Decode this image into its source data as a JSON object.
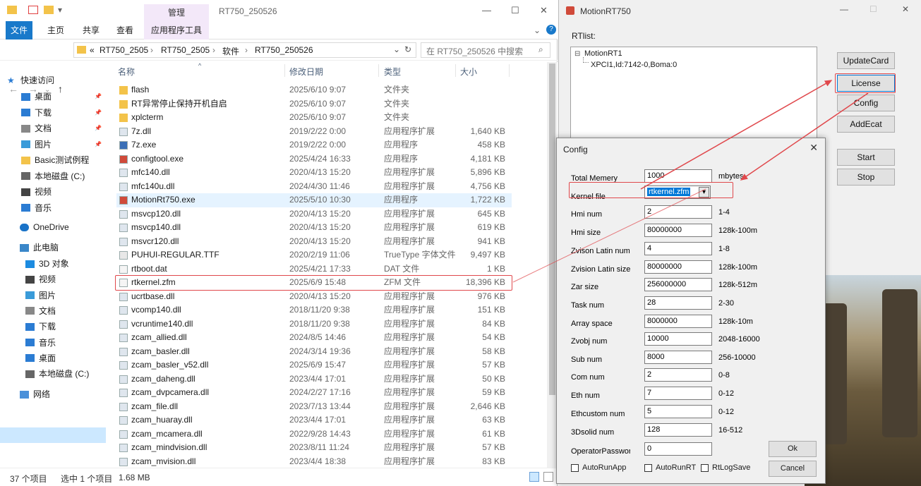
{
  "explorer": {
    "title": "RT750_250526",
    "context_tab": "管理",
    "ribbon_tabs": [
      "文件",
      "主页",
      "共享",
      "查看",
      "应用程序工具"
    ],
    "address": {
      "prefix": "«",
      "parts": [
        "RT750_2505",
        "RT750_2505",
        "软件",
        "RT750_250526"
      ]
    },
    "search_placeholder": "在 RT750_250526 中搜索",
    "nav": {
      "quick_access": "快速访问",
      "quick_items": [
        "桌面",
        "下载",
        "文档",
        "图片",
        "Basic测试例程",
        "本地磁盘 (C:)",
        "视频",
        "音乐"
      ],
      "onedrive": "OneDrive",
      "this_pc": "此电脑",
      "pc_items": [
        "3D 对象",
        "视频",
        "图片",
        "文档",
        "下载",
        "音乐",
        "桌面",
        "本地磁盘 (C:)"
      ],
      "network": "网络"
    },
    "columns": {
      "name": "名称",
      "date": "修改日期",
      "type": "类型",
      "size": "大小"
    },
    "files": [
      {
        "name": "flash",
        "date": "2025/6/10 9:07",
        "type": "文件夹",
        "size": "",
        "kind": "folder"
      },
      {
        "name": "RT异常停止保持开机自启",
        "date": "2025/6/10 9:07",
        "type": "文件夹",
        "size": "",
        "kind": "folder"
      },
      {
        "name": "xplcterm",
        "date": "2025/6/10 9:07",
        "type": "文件夹",
        "size": "",
        "kind": "folder"
      },
      {
        "name": "7z.dll",
        "date": "2019/2/22 0:00",
        "type": "应用程序扩展",
        "size": "1,640 KB",
        "kind": "dll"
      },
      {
        "name": "7z.exe",
        "date": "2019/2/22 0:00",
        "type": "应用程序",
        "size": "458 KB",
        "kind": "exe"
      },
      {
        "name": "configtool.exe",
        "date": "2025/4/24 16:33",
        "type": "应用程序",
        "size": "4,181 KB",
        "kind": "app"
      },
      {
        "name": "mfc140.dll",
        "date": "2020/4/13 15:20",
        "type": "应用程序扩展",
        "size": "5,896 KB",
        "kind": "dll"
      },
      {
        "name": "mfc140u.dll",
        "date": "2024/4/30 11:46",
        "type": "应用程序扩展",
        "size": "4,756 KB",
        "kind": "dll"
      },
      {
        "name": "MotionRt750.exe",
        "date": "2025/5/10 10:30",
        "type": "应用程序",
        "size": "1,722 KB",
        "kind": "app",
        "selected": true
      },
      {
        "name": "msvcp120.dll",
        "date": "2020/4/13 15:20",
        "type": "应用程序扩展",
        "size": "645 KB",
        "kind": "dll"
      },
      {
        "name": "msvcp140.dll",
        "date": "2020/4/13 15:20",
        "type": "应用程序扩展",
        "size": "619 KB",
        "kind": "dll"
      },
      {
        "name": "msvcr120.dll",
        "date": "2020/4/13 15:20",
        "type": "应用程序扩展",
        "size": "941 KB",
        "kind": "dll"
      },
      {
        "name": "PUHUI-REGULAR.TTF",
        "date": "2020/2/19 11:06",
        "type": "TrueType 字体文件",
        "size": "9,497 KB",
        "kind": "font"
      },
      {
        "name": "rtboot.dat",
        "date": "2025/4/21 17:33",
        "type": "DAT 文件",
        "size": "1 KB",
        "kind": "file"
      },
      {
        "name": "rtkernel.zfm",
        "date": "2025/6/9 15:48",
        "type": "ZFM 文件",
        "size": "18,396 KB",
        "kind": "file",
        "highlight": true
      },
      {
        "name": "ucrtbase.dll",
        "date": "2020/4/13 15:20",
        "type": "应用程序扩展",
        "size": "976 KB",
        "kind": "dll"
      },
      {
        "name": "vcomp140.dll",
        "date": "2018/11/20 9:38",
        "type": "应用程序扩展",
        "size": "151 KB",
        "kind": "dll"
      },
      {
        "name": "vcruntime140.dll",
        "date": "2018/11/20 9:38",
        "type": "应用程序扩展",
        "size": "84 KB",
        "kind": "dll"
      },
      {
        "name": "zcam_allied.dll",
        "date": "2024/8/5 14:46",
        "type": "应用程序扩展",
        "size": "54 KB",
        "kind": "dll"
      },
      {
        "name": "zcam_basler.dll",
        "date": "2024/3/14 19:36",
        "type": "应用程序扩展",
        "size": "58 KB",
        "kind": "dll"
      },
      {
        "name": "zcam_basler_v52.dll",
        "date": "2025/6/9 15:47",
        "type": "应用程序扩展",
        "size": "57 KB",
        "kind": "dll"
      },
      {
        "name": "zcam_daheng.dll",
        "date": "2023/4/4 17:01",
        "type": "应用程序扩展",
        "size": "50 KB",
        "kind": "dll"
      },
      {
        "name": "zcam_dvpcamera.dll",
        "date": "2024/2/27 17:16",
        "type": "应用程序扩展",
        "size": "59 KB",
        "kind": "dll"
      },
      {
        "name": "zcam_file.dll",
        "date": "2023/7/13 13:44",
        "type": "应用程序扩展",
        "size": "2,646 KB",
        "kind": "dll"
      },
      {
        "name": "zcam_huaray.dll",
        "date": "2023/4/4 17:01",
        "type": "应用程序扩展",
        "size": "63 KB",
        "kind": "dll"
      },
      {
        "name": "zcam_mcamera.dll",
        "date": "2022/9/28 14:43",
        "type": "应用程序扩展",
        "size": "61 KB",
        "kind": "dll"
      },
      {
        "name": "zcam_mindvision.dll",
        "date": "2023/8/11 11:24",
        "type": "应用程序扩展",
        "size": "57 KB",
        "kind": "dll"
      },
      {
        "name": "zcam_mvision.dll",
        "date": "2023/4/4 18:38",
        "type": "应用程序扩展",
        "size": "83 KB",
        "kind": "dll"
      }
    ],
    "status": {
      "count": "37 个项目",
      "selected": "选中 1 个项目",
      "size": "1.68 MB"
    }
  },
  "motion": {
    "title": "MotionRT750",
    "rtlist_label": "RTlist:",
    "tree_root": "MotionRT1",
    "tree_child": "XPCI1,Id:7142-0,Boma:0",
    "buttons": [
      "UpdateCard",
      "License",
      "Config",
      "AddEcat",
      "Start",
      "Stop"
    ]
  },
  "config": {
    "title": "Config",
    "fields": [
      {
        "label": "Total Memery",
        "value": "1000",
        "range": "mbytes"
      },
      {
        "label": "Kernel file",
        "value": "rtkernel.zfm",
        "range": "",
        "dropdown": true
      },
      {
        "label": "Hmi num",
        "value": "2",
        "range": "1-4"
      },
      {
        "label": "Hmi size",
        "value": "80000000",
        "range": "128k-100m"
      },
      {
        "label": "Zvison Latin num",
        "value": "4",
        "range": "1-8"
      },
      {
        "label": "Zvision Latin size",
        "value": "80000000",
        "range": "128k-100m"
      },
      {
        "label": "Zar size",
        "value": "256000000",
        "range": "128k-512m"
      },
      {
        "label": "Task num",
        "value": "28",
        "range": "2-30"
      },
      {
        "label": "Array space",
        "value": "8000000",
        "range": "128k-10m"
      },
      {
        "label": "Zvobj num",
        "value": "10000",
        "range": "2048-16000"
      },
      {
        "label": "Sub num",
        "value": "8000",
        "range": "256-10000"
      },
      {
        "label": "Com num",
        "value": "2",
        "range": "0-8"
      },
      {
        "label": "Eth num",
        "value": "7",
        "range": "0-12"
      },
      {
        "label": "Ethcustom num",
        "value": "5",
        "range": "0-12"
      },
      {
        "label": "3Dsolid num",
        "value": "128",
        "range": "16-512"
      },
      {
        "label": "OperatorPassworc",
        "value": "0",
        "range": ""
      }
    ],
    "ok": "Ok",
    "cancel": "Cancel",
    "checkboxes": [
      "AutoRunApp",
      "AutoRunRT",
      "RtLogSave"
    ]
  },
  "colors": {
    "accent": "#1979ca",
    "highlight_red": "#e0484c",
    "selection": "#cce8ff"
  }
}
